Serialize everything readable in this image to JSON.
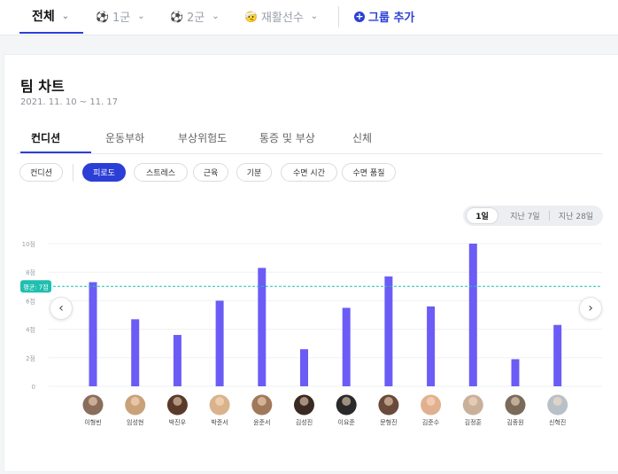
{
  "group_tabs": [
    {
      "label": "전체",
      "emoji": ""
    },
    {
      "label": "1군",
      "emoji": "⚽"
    },
    {
      "label": "2군",
      "emoji": "⚽"
    },
    {
      "label": "재활선수",
      "emoji": "🤕"
    }
  ],
  "add_group_label": "그룹 추가",
  "card": {
    "title": "팀 차트",
    "period": "2021. 11. 10 ~ 11. 17"
  },
  "category_tabs": [
    "컨디션",
    "운동부하",
    "부상위험도",
    "통증 및 부상",
    "신체"
  ],
  "metric_pills": [
    "컨디션",
    "피로도",
    "스트레스",
    "근육",
    "기분",
    "수면 시간",
    "수면 품질"
  ],
  "range_options": [
    "1일",
    "지난 7일",
    "지난 28일"
  ],
  "nav": {
    "prev": "‹",
    "next": "›"
  },
  "colors": {
    "accent": "#2b3fd6",
    "bar": "#6b5cf6",
    "avg": "#1fbfb0"
  },
  "chart_data": {
    "type": "bar",
    "categories": [
      "이형빈",
      "임성현",
      "박진우",
      "박준서",
      "윤준서",
      "김성진",
      "이요준",
      "문형진",
      "김준수",
      "김정훈",
      "김종원",
      "신혁진"
    ],
    "values": [
      7.3,
      4.7,
      3.6,
      6.0,
      8.3,
      2.6,
      5.5,
      7.7,
      5.6,
      10,
      1.9,
      4.3
    ],
    "y_ticks": [
      "0",
      "2점",
      "4점",
      "6점",
      "8점",
      "10점"
    ],
    "ylim": [
      0,
      10
    ],
    "average": 7,
    "average_label": "평균: 7점",
    "grid": true
  }
}
